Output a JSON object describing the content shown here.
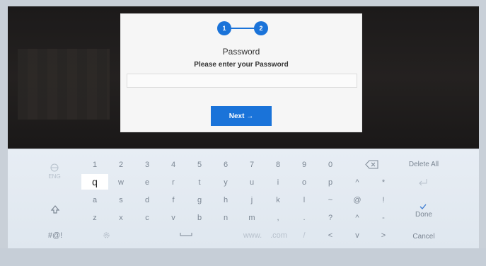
{
  "dialog": {
    "step1": "1",
    "step2": "2",
    "title": "Password",
    "subtitle": "Please enter your Password",
    "password_value": "",
    "next_label": "Next →"
  },
  "keyboard": {
    "row1": [
      "1",
      "2",
      "3",
      "4",
      "5",
      "6",
      "7",
      "8",
      "9",
      "0"
    ],
    "row2": [
      "q",
      "w",
      "e",
      "r",
      "t",
      "y",
      "u",
      "i",
      "o",
      "p",
      "^",
      "*"
    ],
    "row3": [
      "a",
      "s",
      "d",
      "f",
      "g",
      "h",
      "j",
      "k",
      "l",
      "~",
      "@",
      "!"
    ],
    "row4": [
      "z",
      "x",
      "c",
      "v",
      "b",
      "n",
      "m",
      ",",
      ".",
      "?",
      "^",
      "-"
    ],
    "bottom": {
      "symbols": "#@!",
      "domain_www": "www.",
      "domain_com": ".com",
      "slash": "/",
      "left": "<",
      "down": "v",
      "right": ">"
    },
    "functions": {
      "delete_all": "Delete All",
      "done": "Done",
      "cancel": "Cancel",
      "lang": "ENG"
    }
  },
  "icons": {
    "backspace": "backspace-icon",
    "shift": "shift-icon",
    "enter": "enter-icon",
    "settings": "gear-icon",
    "space": "space-icon",
    "globe": "globe-icon",
    "check": "check-icon"
  },
  "colors": {
    "accent": "#1a73d9"
  }
}
